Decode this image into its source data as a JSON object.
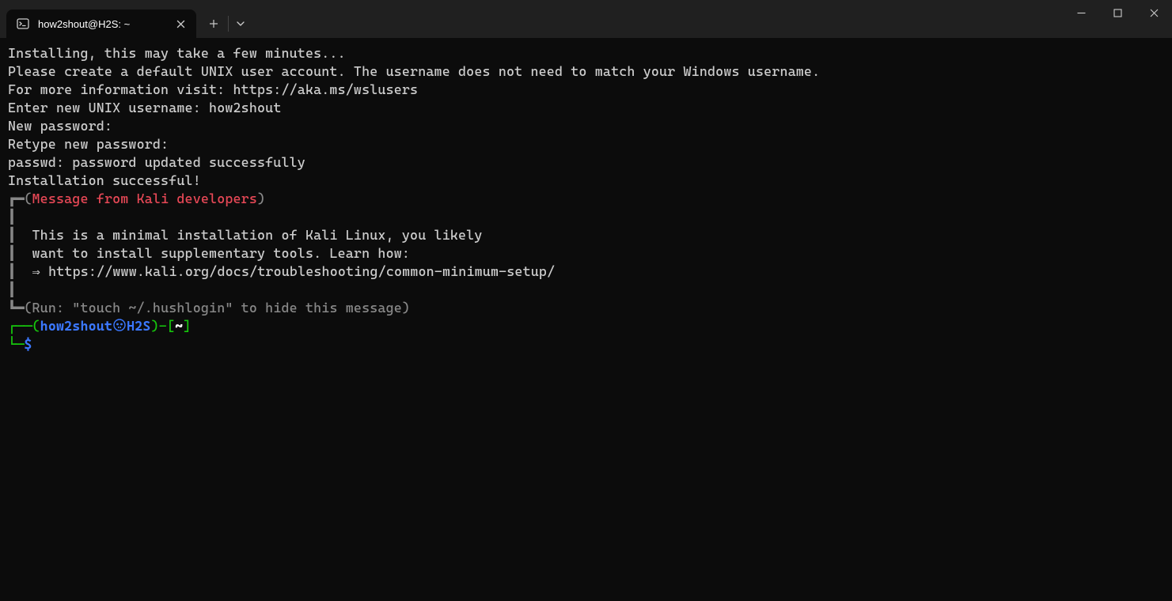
{
  "titlebar": {
    "tab": {
      "title": "how2shout@H2S: ~",
      "close_glyph": "✕"
    },
    "new_tab_glyph": "＋",
    "chevron_glyph": "⌄"
  },
  "terminal": {
    "lines": {
      "l0": "Installing, this may take a few minutes...",
      "l1": "Please create a default UNIX user account. The username does not need to match your Windows username.",
      "l2": "For more information visit: https://aka.ms/wslusers",
      "l3a": "Enter new UNIX username: ",
      "l3b": "how2shout",
      "l4": "New password:",
      "l5": "Retype new password:",
      "l6": "passwd: password updated successfully",
      "l7": "Installation successful!"
    },
    "box": {
      "top_corner": "┏━",
      "mid_pipe": "┃",
      "bot_corner": "┗━",
      "open_paren": "(",
      "close_paren": ")",
      "msg_header": "Message from Kali developers",
      "body1": "  This is a minimal installation of Kali Linux, you likely",
      "body2": "  want to install supplementary tools. Learn how:",
      "body3": "  ⇒ https://www.kali.org/docs/troubleshooting/common-minimum-setup/",
      "hush": "Run: \"touch ~/.hushlogin\" to hide this message"
    },
    "prompt": {
      "corner_top": "┌──",
      "corner_bot": "└─",
      "open_paren": "(",
      "user": "how2shout",
      "host": "H2S",
      "close_paren": ")",
      "dash": "-",
      "lbracket": "[",
      "path": "~",
      "rbracket": "]",
      "dollar": "$"
    }
  }
}
